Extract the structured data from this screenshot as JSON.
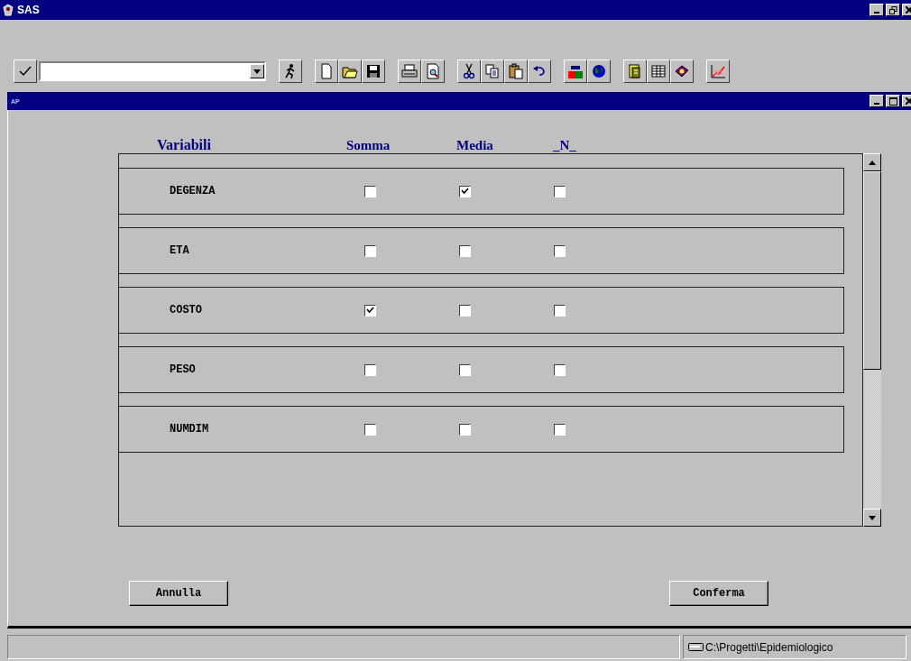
{
  "window": {
    "title": "SAS"
  },
  "document": {
    "title": "AP"
  },
  "columns": [
    "Variabili",
    "Somma",
    "Media",
    "_N_"
  ],
  "rows": [
    {
      "name": "DEGENZA",
      "checks": [
        {
          "checked": false
        },
        {
          "checked": true
        },
        {
          "checked": false
        }
      ]
    },
    {
      "name": "ETA",
      "checks": [
        {
          "checked": false
        },
        {
          "checked": false
        },
        {
          "checked": false
        }
      ]
    },
    {
      "name": "COSTO",
      "checks": [
        {
          "checked": true
        },
        {
          "checked": false
        },
        {
          "checked": false
        }
      ]
    },
    {
      "name": "PESO",
      "checks": [
        {
          "checked": false
        },
        {
          "checked": false
        },
        {
          "checked": false
        }
      ]
    },
    {
      "name": "NUMDIM",
      "checks": [
        {
          "checked": false
        },
        {
          "checked": false
        },
        {
          "checked": false
        }
      ]
    }
  ],
  "buttons": [
    "Annulla",
    "Conferma"
  ],
  "status_bar": {
    "path": "C:\\Progetti\\Epidemiologico"
  }
}
